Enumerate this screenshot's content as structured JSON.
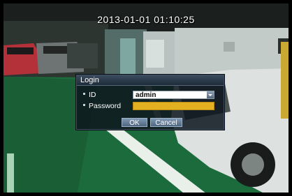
{
  "osd": {
    "timestamp": "2013-01-01 01:10:25"
  },
  "login": {
    "title": "Login",
    "id_label": "ID",
    "id_value": "admin",
    "password_label": "Password",
    "password_value": "",
    "ok_label": "OK",
    "cancel_label": "Cancel"
  },
  "colors": {
    "password_field": "#e3b022",
    "button": "#5f7893",
    "dialog_bg": "#0e161e"
  }
}
